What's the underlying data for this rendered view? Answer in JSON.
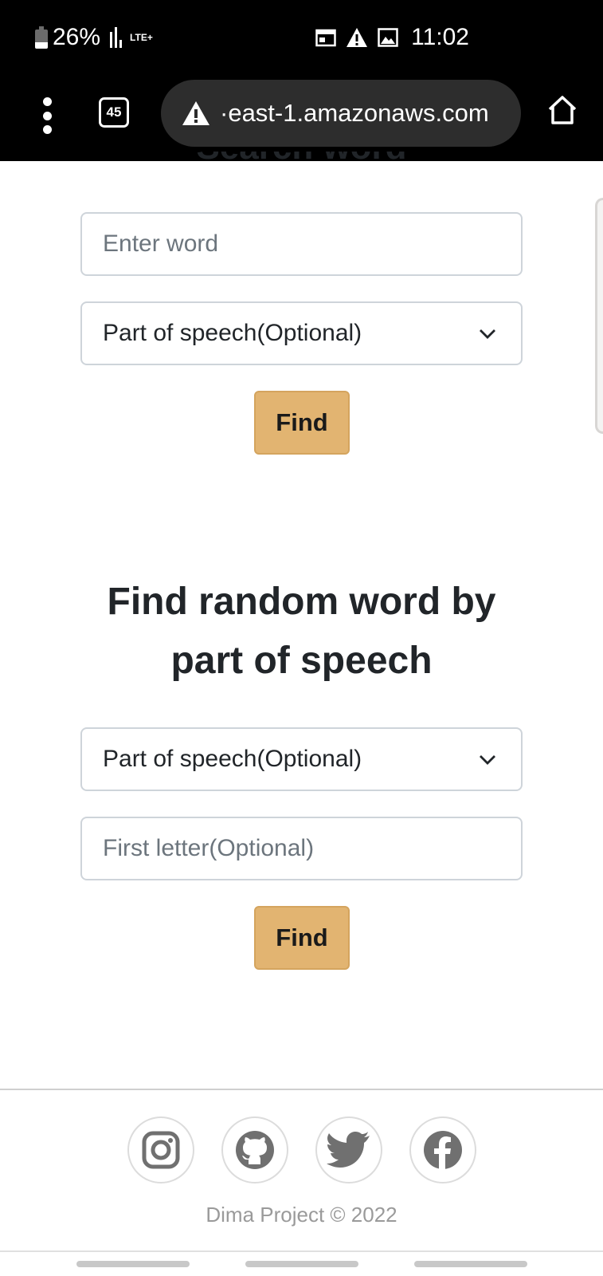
{
  "status_bar": {
    "battery": "26%",
    "network": "LTE+",
    "time": "11:02"
  },
  "browser": {
    "tab_count": "45",
    "url": "·east-1.amazonaws.com"
  },
  "search_word": {
    "word_placeholder": "Enter word",
    "part_of_speech_selected": "Part of speech(Optional)",
    "find_label": "Find"
  },
  "random_word": {
    "heading_line1": "Find random word by",
    "heading_line2": "part of speech",
    "part_of_speech_selected": "Part of speech(Optional)",
    "first_letter_placeholder": "First letter(Optional)",
    "find_label": "Find"
  },
  "footer": {
    "social_icons": [
      "instagram-icon",
      "github-icon",
      "twitter-icon",
      "facebook-icon"
    ],
    "copyright": "Dima Project © 2022"
  },
  "colors": {
    "button_bg": "#e2b471",
    "icon_gray": "#707070"
  }
}
